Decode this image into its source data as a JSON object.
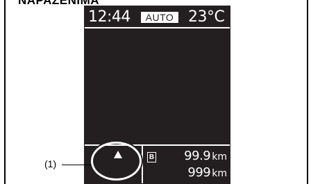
{
  "page": {
    "title": "NAPAZENIMA"
  },
  "display": {
    "time": "12:44",
    "mode": "AUTO",
    "temperature": "23°C",
    "indicator_icon": "arrow-up-icon",
    "trip_badge": "B",
    "trip_distance": "99.9",
    "trip_distance_unit": "km",
    "range": "999",
    "range_unit": "km"
  },
  "callout": {
    "label": "(1)"
  },
  "colors": {
    "screen_background": "#231f20",
    "screen_foreground": "#ffffff",
    "page_background": "#ffffff",
    "ink": "#000000"
  }
}
